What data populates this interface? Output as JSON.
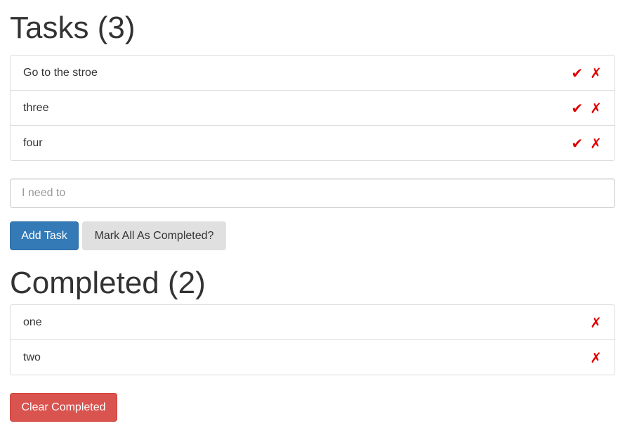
{
  "tasks": {
    "heading": "Tasks (3)",
    "items": [
      {
        "label": "Go to the stroe"
      },
      {
        "label": "three"
      },
      {
        "label": "four"
      }
    ]
  },
  "actions": {
    "complete_symbol": "✔",
    "delete_symbol": "✗",
    "color": "#e00000"
  },
  "input": {
    "placeholder": "I need to",
    "value": ""
  },
  "buttons": {
    "add_task": "Add Task",
    "mark_all": "Mark All As Completed?",
    "clear_completed": "Clear Completed"
  },
  "completed": {
    "heading": "Completed (2)",
    "items": [
      {
        "label": "one"
      },
      {
        "label": "two"
      }
    ]
  },
  "colors": {
    "primary": "#337ab7",
    "default": "#e0e0e0",
    "danger": "#d9534f",
    "text": "#333333",
    "border": "#dddddd"
  }
}
